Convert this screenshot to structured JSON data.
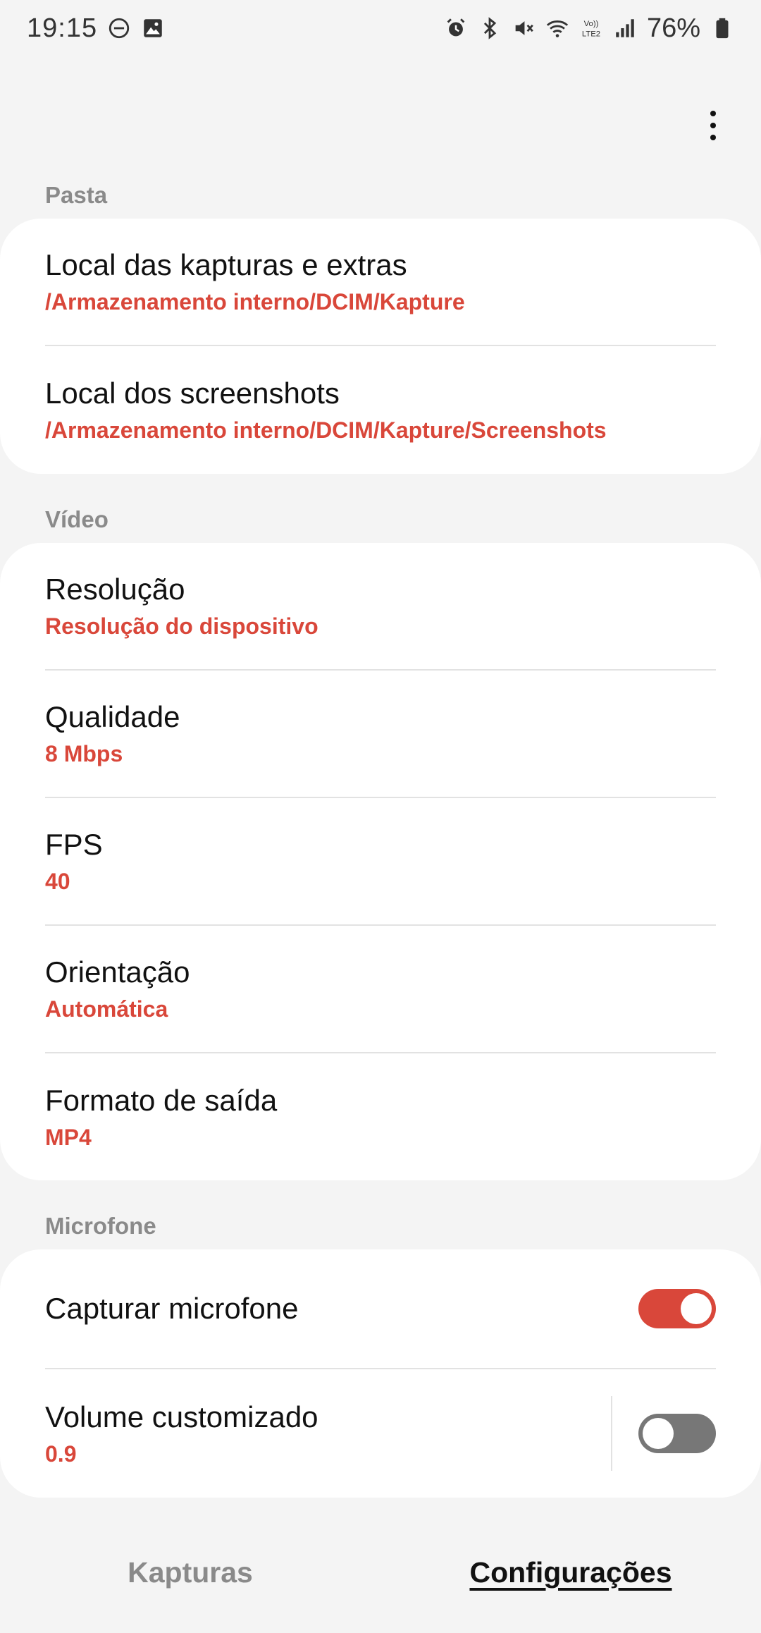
{
  "status_bar": {
    "time": "19:15",
    "left_icons": [
      "dnd-icon",
      "image-icon"
    ],
    "right_icons": [
      "alarm-icon",
      "bluetooth-icon",
      "mute-icon",
      "wifi-icon",
      "volte-icon",
      "signal-icon"
    ],
    "volte_label": "Vo))\nLTE2",
    "battery_percent": "76%"
  },
  "sections": {
    "pasta": {
      "header": "Pasta",
      "items": [
        {
          "title": "Local das kapturas e extras",
          "value": "/Armazenamento interno/DCIM/Kapture"
        },
        {
          "title": "Local dos screenshots",
          "value": "/Armazenamento interno/DCIM/Kapture/Screenshots"
        }
      ]
    },
    "video": {
      "header": "Vídeo",
      "items": [
        {
          "title": "Resolução",
          "value": "Resolução do dispositivo"
        },
        {
          "title": "Qualidade",
          "value": "8 Mbps"
        },
        {
          "title": "FPS",
          "value": "40"
        },
        {
          "title": "Orientação",
          "value": "Automática"
        },
        {
          "title": "Formato de saída",
          "value": "MP4"
        }
      ]
    },
    "microfone": {
      "header": "Microfone",
      "items": [
        {
          "title": "Capturar microfone",
          "toggle": true
        },
        {
          "title": "Volume customizado",
          "value": "0.9",
          "toggle": false
        }
      ]
    }
  },
  "bottom_nav": {
    "tab1": "Kapturas",
    "tab2": "Configurações",
    "active": "Configurações"
  },
  "colors": {
    "accent": "#d9473a",
    "background": "#f4f4f4",
    "card": "#ffffff",
    "header_text": "#8a8a8a"
  }
}
